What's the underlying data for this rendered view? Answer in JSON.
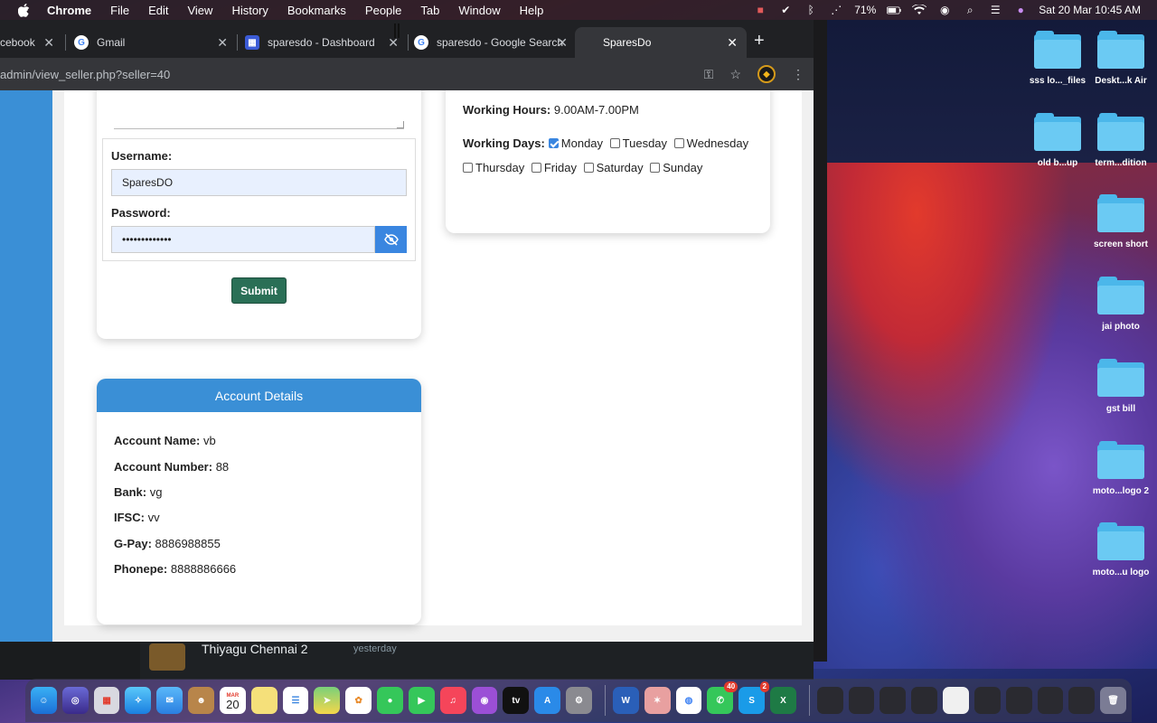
{
  "menubar": {
    "app": "Chrome",
    "items": [
      "File",
      "Edit",
      "View",
      "History",
      "Bookmarks",
      "People",
      "Tab",
      "Window",
      "Help"
    ],
    "battery": "71%",
    "datetime": "Sat 20 Mar  10:45 AM"
  },
  "browser": {
    "tabs": [
      {
        "label": "cebook"
      },
      {
        "label": "Gmail"
      },
      {
        "label": "sparesdo - Dashboard"
      },
      {
        "label": "sparesdo - Google Search"
      },
      {
        "label": "SparesDo"
      }
    ],
    "url": "admin/view_seller.php?seller=40"
  },
  "login": {
    "username_label": "Username:",
    "username_value": "SparesDO",
    "password_label": "Password:",
    "password_value": "•••••••••••••",
    "submit_label": "Submit"
  },
  "schedule": {
    "hours_label": "Working Hours:",
    "hours_value": "9.00AM-7.00PM",
    "days_label": "Working Days:",
    "days": [
      {
        "name": "Monday",
        "checked": true
      },
      {
        "name": "Tuesday",
        "checked": false
      },
      {
        "name": "Wednesday",
        "checked": false
      },
      {
        "name": "Thursday",
        "checked": false
      },
      {
        "name": "Friday",
        "checked": false
      },
      {
        "name": "Saturday",
        "checked": false
      },
      {
        "name": "Sunday",
        "checked": false
      }
    ]
  },
  "account": {
    "title": "Account Details",
    "rows": [
      {
        "label": "Account Name:",
        "value": "vb"
      },
      {
        "label": "Account Number:",
        "value": "88"
      },
      {
        "label": "Bank:",
        "value": "vg"
      },
      {
        "label": "IFSC:",
        "value": "vv"
      },
      {
        "label": "G-Pay:",
        "value": "8886988855"
      },
      {
        "label": "Phonepe:",
        "value": "8888886666"
      }
    ]
  },
  "background_window": {
    "name": "Thiyagu Chennai 2",
    "time": "yesterday"
  },
  "desktop": {
    "icons": [
      {
        "label": "sss lo..._files"
      },
      {
        "label": "Deskt...k Air"
      },
      {
        "label": "old b...up"
      },
      {
        "label": "term...dition"
      },
      {
        "label": "screen short"
      },
      {
        "label": "jai photo"
      },
      {
        "label": "gst bill"
      },
      {
        "label": "moto...logo 2"
      },
      {
        "label": "moto...u logo"
      }
    ]
  },
  "dock": {
    "calendar_month": "MAR",
    "calendar_day": "20",
    "whatsapp_badge": "40",
    "skype_badge": "2"
  },
  "colors": {
    "header_blue": "#3a8fd6",
    "submit_green": "#2a6f56",
    "input_fill": "#e8f0fe"
  }
}
